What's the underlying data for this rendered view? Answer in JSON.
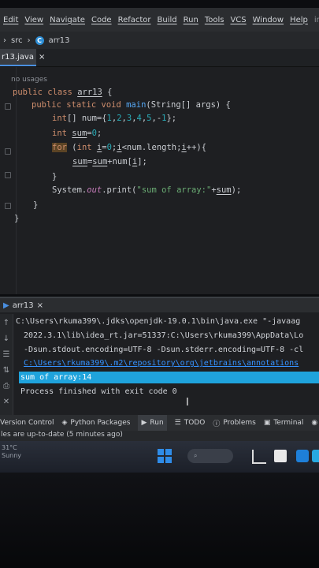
{
  "menu": {
    "items": [
      "Edit",
      "View",
      "Navigate",
      "Code",
      "Refactor",
      "Build",
      "Run",
      "Tools",
      "VCS",
      "Window",
      "Help"
    ],
    "overflow": "in"
  },
  "breadcrumb": {
    "folder": "src",
    "file": "arr13"
  },
  "editor_tab": {
    "filename": "r13.java",
    "close": "×"
  },
  "code": {
    "usages": "no usages",
    "lines": [
      "public class arr13 {",
      "public static void main(String[] args) {",
      "int[] num={1,2,3,4,5,-1};",
      "int sum=0;",
      "for (int i=0;i<num.length;i++){",
      "sum=sum+num[i];",
      "}",
      "System.out.print(\"sum of array:\"+sum);",
      "}",
      "}"
    ]
  },
  "run_panel": {
    "tab": "arr13",
    "close": "×",
    "console": [
      "C:\\Users\\rkuma399\\.jdks\\openjdk-19.0.1\\bin\\java.exe \"-javaag",
      "2022.3.1\\lib\\idea_rt.jar=51337:C:\\Users\\rkuma399\\AppData\\Lo",
      "-Dsun.stdout.encoding=UTF-8 -Dsun.stderr.encoding=UTF-8 -cl",
      "C:\\Users\\rkuma399\\.m2\\repository\\org\\jetbrains\\annotations",
      "sum of array:14",
      "Process finished with exit code 0"
    ]
  },
  "toolwindow_bar": {
    "version_control": "Version Control",
    "python_packages": "Python Packages",
    "run": "Run",
    "todo": "TODO",
    "problems": "Problems",
    "terminal": "Terminal",
    "overflow": "S"
  },
  "status": {
    "message": "les are up-to-date (5 minutes ago)"
  },
  "taskbar": {
    "weather_temp": "31°C",
    "weather_desc": "Sunny"
  },
  "colors": {
    "keyword": "#cf8e6d",
    "function": "#56a8f5",
    "number": "#2aacb8",
    "string": "#6aab73",
    "link": "#3592ff",
    "selection": "#1fa3dc",
    "accent": "#4a8fe0"
  }
}
